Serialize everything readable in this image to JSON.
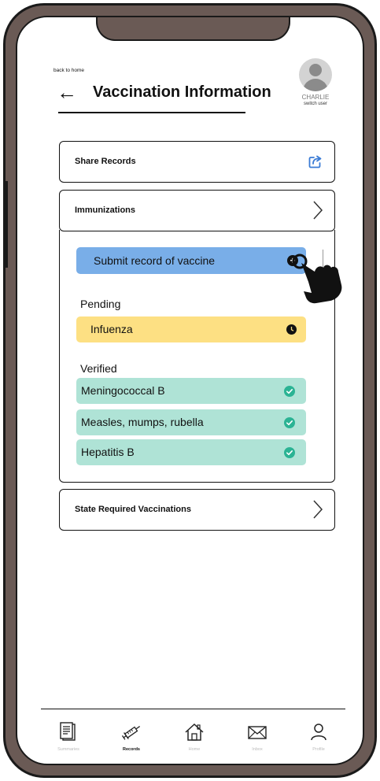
{
  "header": {
    "back_label": "back to home",
    "title": "Vaccination Information",
    "user_name": "CHARLIE",
    "switch_user": "switch user"
  },
  "cards": {
    "share": "Share Records",
    "immunizations": "Immunizations",
    "state_required": "State Required Vaccinations"
  },
  "immunizations": {
    "submit_label": "Submit record of vaccine",
    "pending_heading": "Pending",
    "pending": [
      "Infuenza"
    ],
    "verified_heading": "Verified",
    "verified": [
      "Meningococcal B",
      "Measles, mumps, rubella",
      "Hepatitis B"
    ]
  },
  "nav": {
    "items": [
      {
        "label": "Summaries",
        "icon": "document-icon",
        "active": false
      },
      {
        "label": "Records",
        "icon": "syringe-icon",
        "active": true
      },
      {
        "label": "Home",
        "icon": "home-icon",
        "active": false
      },
      {
        "label": "Inbox",
        "icon": "envelope-icon",
        "active": false
      },
      {
        "label": "Profile",
        "icon": "person-icon",
        "active": false
      }
    ]
  },
  "colors": {
    "submit": "#79aee8",
    "pending": "#fde083",
    "verified": "#afe3d6",
    "frame": "#6a5a55"
  }
}
